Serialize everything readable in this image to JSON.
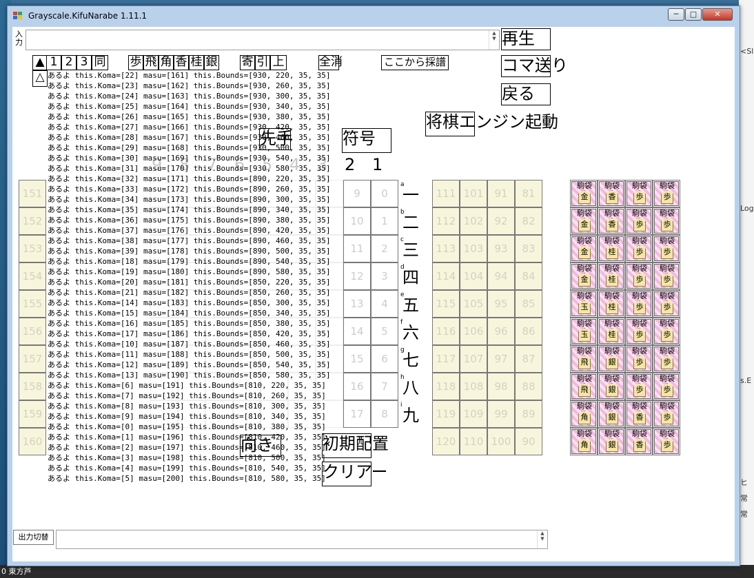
{
  "window": {
    "title": "Grayscale.KifuNarabe 1.11.1",
    "controls": {
      "minimize": "─",
      "maximize": "□",
      "close": "✕"
    }
  },
  "desktop": {
    "right_texts": [
      "<Sl",
      "Log",
      "s.E",
      "ヒ",
      "常",
      "常"
    ],
    "taskbar_text": "0 東方芦"
  },
  "input": {
    "label": "入力",
    "value": ""
  },
  "output": {
    "toggle_label": "出力切替",
    "value": ""
  },
  "buttons": {
    "play": "再生",
    "step": "コマ送り",
    "back": "戻る",
    "engine": "将棋エンジン起動",
    "sente": "先手",
    "symbol": "符号",
    "direction": "向き",
    "initial": "初期配置",
    "clear": "クリアー"
  },
  "toolbar": {
    "row1": [
      "▲",
      "1",
      "2",
      "3",
      "同",
      "歩",
      "飛",
      "角",
      "香",
      "桂",
      "銀",
      "寄",
      "引",
      "上",
      "全消",
      "ここから採譜"
    ],
    "row2": [
      "△"
    ]
  },
  "board": {
    "files": [
      "9",
      "8",
      "7",
      "6",
      "5",
      "4",
      "3",
      "2",
      "1"
    ],
    "ranks": [
      "一",
      "二",
      "三",
      "四",
      "五",
      "六",
      "七",
      "八",
      "九"
    ],
    "rank_letters": [
      "a",
      "b",
      "c",
      "d",
      "e",
      "f",
      "g",
      "h",
      "i"
    ],
    "col_second_to_last": [
      "9",
      "10",
      "11",
      "12",
      "13",
      "14",
      "15",
      "16",
      "17"
    ],
    "col_last": [
      "0",
      "1",
      "2",
      "3",
      "4",
      "5",
      "6",
      "7",
      "8"
    ]
  },
  "left_stand": {
    "cells": [
      "151",
      "152",
      "153",
      "154",
      "155",
      "156",
      "157",
      "158",
      "159",
      "160"
    ]
  },
  "right_stand": {
    "rows": [
      [
        "111",
        "101",
        "91",
        "81"
      ],
      [
        "112",
        "102",
        "92",
        "82"
      ],
      [
        "113",
        "103",
        "93",
        "83"
      ],
      [
        "114",
        "104",
        "94",
        "84"
      ],
      [
        "115",
        "105",
        "95",
        "85"
      ],
      [
        "116",
        "106",
        "96",
        "86"
      ],
      [
        "117",
        "107",
        "97",
        "87"
      ],
      [
        "118",
        "108",
        "98",
        "88"
      ],
      [
        "119",
        "109",
        "99",
        "89"
      ],
      [
        "120",
        "110",
        "100",
        "90"
      ]
    ]
  },
  "piece_bag": {
    "label": "駒袋",
    "rows": [
      [
        "金",
        "香",
        "歩",
        "歩"
      ],
      [
        "金",
        "香",
        "歩",
        "歩"
      ],
      [
        "金",
        "桂",
        "歩",
        "歩"
      ],
      [
        "金",
        "桂",
        "歩",
        "歩"
      ],
      [
        "玉",
        "桂",
        "歩",
        "歩"
      ],
      [
        "玉",
        "桂",
        "歩",
        "歩"
      ],
      [
        "飛",
        "銀",
        "歩",
        "歩"
      ],
      [
        "飛",
        "銀",
        "歩",
        "歩"
      ],
      [
        "角",
        "銀",
        "香",
        "歩"
      ],
      [
        "角",
        "銀",
        "香",
        "歩"
      ]
    ]
  },
  "log_lines": [
    "あるよ this.Koma=[22] masu=[161] this.Bounds=[930, 220, 35, 35]",
    "あるよ this.Koma=[23] masu=[162] this.Bounds=[930, 260, 35, 35]",
    "あるよ this.Koma=[24] masu=[163] this.Bounds=[930, 300, 35, 35]",
    "あるよ this.Koma=[25] masu=[164] this.Bounds=[930, 340, 35, 35]",
    "あるよ this.Koma=[26] masu=[165] this.Bounds=[930, 380, 35, 35]",
    "あるよ this.Koma=[27] masu=[166] this.Bounds=[930, 420, 35, 35]",
    "あるよ this.Koma=[28] masu=[167] this.Bounds=[930, 460, 35, 35]",
    "あるよ this.Koma=[29] masu=[168] this.Bounds=[930, 500, 35, 35]",
    "あるよ this.Koma=[30] masu=[169] this.Bounds=[930, 540, 35, 35]",
    "あるよ this.Koma=[31] masu=[170] this.Bounds=[930, 580, 35, 35]",
    "あるよ this.Koma=[32] masu=[171] this.Bounds=[890, 220, 35, 35]",
    "あるよ this.Koma=[33] masu=[172] this.Bounds=[890, 260, 35, 35]",
    "あるよ this.Koma=[34] masu=[173] this.Bounds=[890, 300, 35, 35]",
    "あるよ this.Koma=[35] masu=[174] this.Bounds=[890, 340, 35, 35]",
    "あるよ this.Koma=[36] masu=[175] this.Bounds=[890, 380, 35, 35]",
    "あるよ this.Koma=[37] masu=[176] this.Bounds=[890, 420, 35, 35]",
    "あるよ this.Koma=[38] masu=[177] this.Bounds=[890, 460, 35, 35]",
    "あるよ this.Koma=[39] masu=[178] this.Bounds=[890, 500, 35, 35]",
    "あるよ this.Koma=[18] masu=[179] this.Bounds=[890, 540, 35, 35]",
    "あるよ this.Koma=[19] masu=[180] this.Bounds=[890, 580, 35, 35]",
    "あるよ this.Koma=[20] masu=[181] this.Bounds=[850, 220, 35, 35]",
    "あるよ this.Koma=[21] masu=[182] this.Bounds=[850, 260, 35, 35]",
    "あるよ this.Koma=[14] masu=[183] this.Bounds=[850, 300, 35, 35]",
    "あるよ this.Koma=[15] masu=[184] this.Bounds=[850, 340, 35, 35]",
    "あるよ this.Koma=[16] masu=[185] this.Bounds=[850, 380, 35, 35]",
    "あるよ this.Koma=[17] masu=[186] this.Bounds=[850, 420, 35, 35]",
    "あるよ this.Koma=[10] masu=[187] this.Bounds=[850, 460, 35, 35]",
    "あるよ this.Koma=[11] masu=[188] this.Bounds=[850, 500, 35, 35]",
    "あるよ this.Koma=[12] masu=[189] this.Bounds=[850, 540, 35, 35]",
    "あるよ this.Koma=[13] masu=[190] this.Bounds=[850, 580, 35, 35]",
    "あるよ this.Koma=[6] masu=[191] this.Bounds=[810, 220, 35, 35]",
    "あるよ this.Koma=[7] masu=[192] this.Bounds=[810, 260, 35, 35]",
    "あるよ this.Koma=[8] masu=[193] this.Bounds=[810, 300, 35, 35]",
    "あるよ this.Koma=[9] masu=[194] this.Bounds=[810, 340, 35, 35]",
    "あるよ this.Koma=[0] masu=[195] this.Bounds=[810, 380, 35, 35]",
    "あるよ this.Koma=[1] masu=[196] this.Bounds=[810, 420, 35, 35]",
    "あるよ this.Koma=[2] masu=[197] this.Bounds=[810, 460, 35, 35]",
    "あるよ this.Koma=[3] masu=[198] this.Bounds=[810, 500, 35, 35]",
    "あるよ this.Koma=[4] masu=[199] this.Bounds=[810, 540, 35, 35]",
    "あるよ this.Koma=[5] masu=[200] this.Bounds=[810, 580, 35, 35]"
  ]
}
